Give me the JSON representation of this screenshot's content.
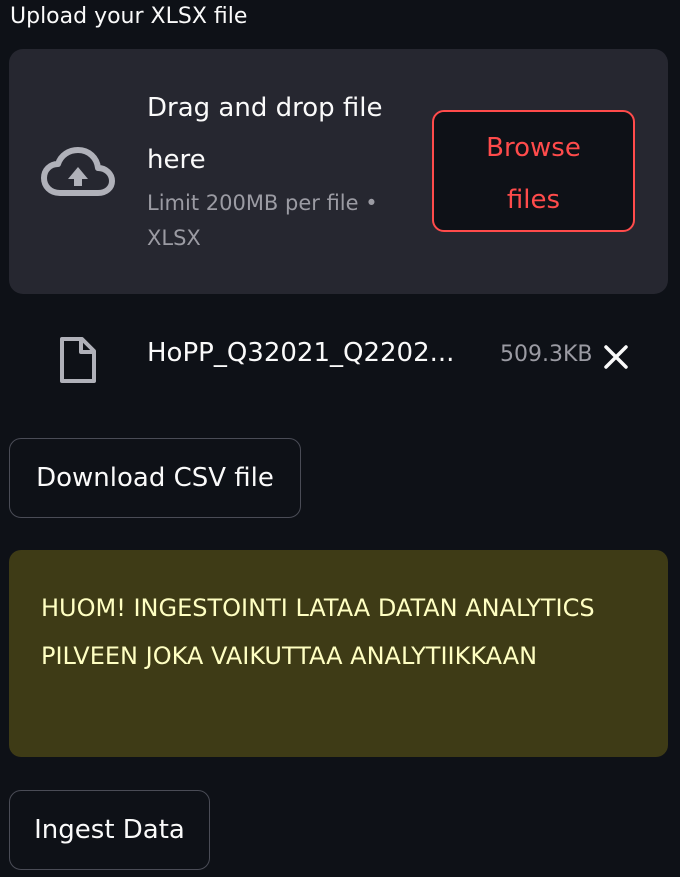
{
  "uploader": {
    "label": "Upload your XLSX file",
    "drop_title": "Drag and drop file here",
    "limit_text": "Limit 200MB per file • XLSX",
    "browse_label": "Browse files",
    "icon": "cloud-upload-icon"
  },
  "uploaded_file": {
    "name": "HoPP_Q32021_Q2202...",
    "size": "509.3KB",
    "file_icon": "file-icon",
    "remove_icon": "close-icon"
  },
  "actions": {
    "download_label": "Download CSV file",
    "ingest_label": "Ingest Data"
  },
  "warning": {
    "text": "HUOM! INGESTOINTI LATAA DATAN ANALYTICS PILVEEN JOKA VAIKUTTAA ANALYTIIKKAAN"
  },
  "colors": {
    "background": "#0e1117",
    "dropzone": "#262730",
    "accent": "#ff4b4b",
    "warning_bg": "#3e3b16",
    "warning_text": "#ffffc2"
  }
}
